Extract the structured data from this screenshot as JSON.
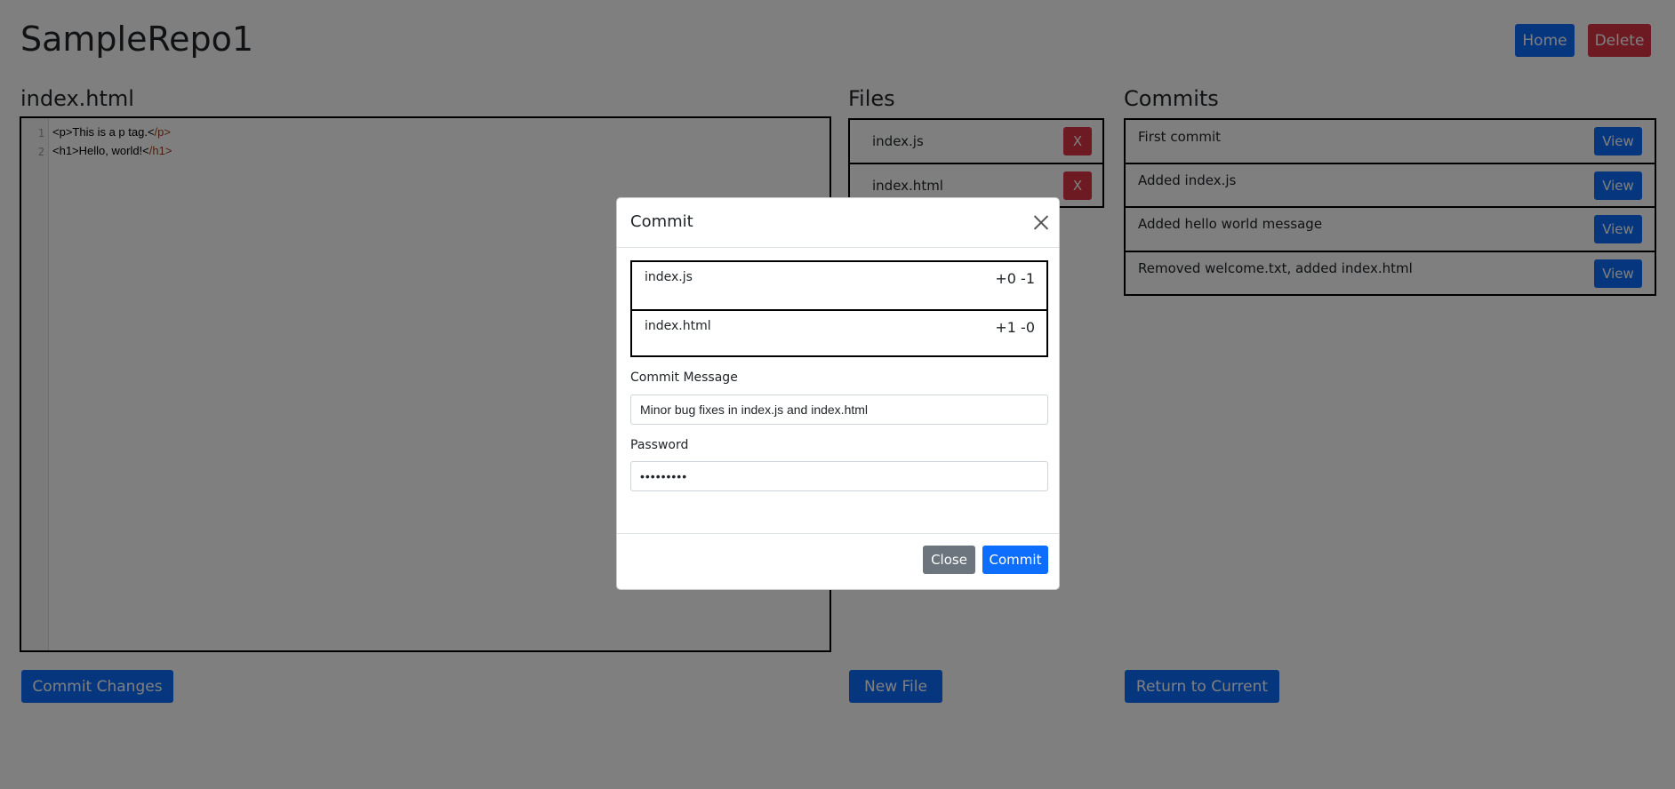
{
  "header": {
    "repo_name": "SampleRepo1",
    "home_label": "Home",
    "delete_label": "Delete"
  },
  "editor": {
    "filename": "index.html",
    "lines": [
      {
        "number": "1",
        "open": "<p>This is a p tag.<",
        "close": "/p>"
      },
      {
        "number": "2",
        "open": "<h1>Hello, world!<",
        "close": "/h1>"
      }
    ],
    "commit_button": "Commit Changes"
  },
  "files": {
    "title": "Files",
    "items": [
      {
        "name": "index.js",
        "remove_label": "X"
      },
      {
        "name": "index.html",
        "remove_label": "X"
      }
    ],
    "new_file_button": "New File"
  },
  "commits": {
    "title": "Commits",
    "items": [
      {
        "message": "First commit",
        "view_label": "View"
      },
      {
        "message": "Added index.js",
        "view_label": "View"
      },
      {
        "message": "Added hello world message",
        "view_label": "View"
      },
      {
        "message": "Removed welcome.txt, added index.html",
        "view_label": "View"
      }
    ],
    "return_button": "Return to Current"
  },
  "modal": {
    "title": "Commit",
    "changes": [
      {
        "file": "index.js",
        "stat": "+0 -1"
      },
      {
        "file": "index.html",
        "stat": "+1 -0"
      }
    ],
    "message_label": "Commit Message",
    "message_value": "Minor bug fixes in index.js and index.html",
    "password_label": "Password",
    "password_value": "•••••••••",
    "close_label": "Close",
    "commit_label": "Commit"
  },
  "colors": {
    "primary": "#0d6efd",
    "danger": "#dc3545",
    "secondary": "#6c757d",
    "backdrop": "rgba(0,0,0,0.5)"
  }
}
